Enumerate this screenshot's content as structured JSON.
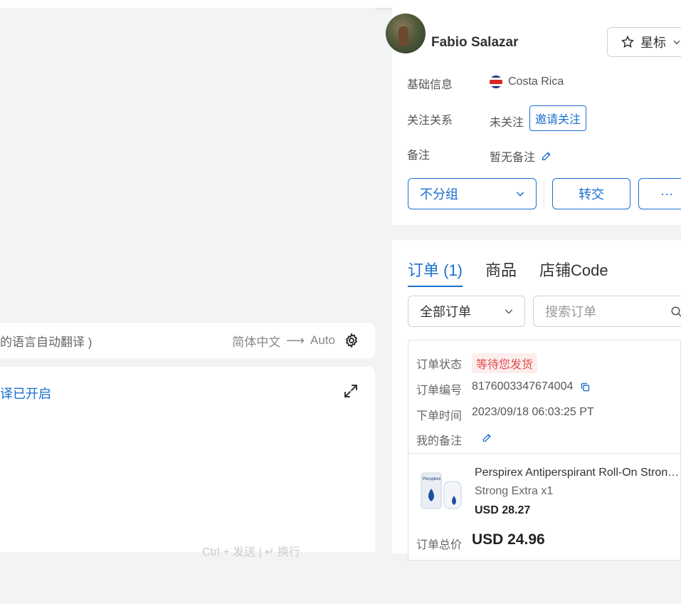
{
  "chat": {
    "translate_hint": "的语言自动翻译 )",
    "source_lang": "简体中文",
    "arrow": "⟶",
    "target_lang": "Auto",
    "editor_status": "译已开启",
    "send_hint": "Ctrl + 发送 | ↵ 换行"
  },
  "profile": {
    "name": "Fabio Salazar",
    "star_label": "星标",
    "basic_label": "基础信息",
    "country": "Costa Rica",
    "follow_label": "关注关系",
    "follow_value": "未关注",
    "invite_label": "邀请关注",
    "note_label": "备注",
    "note_value": "暂无备注",
    "group_value": "不分组",
    "transfer_label": "转交",
    "more_label": "···"
  },
  "orders": {
    "tabs": [
      {
        "label": "订单 (1)",
        "active": true
      },
      {
        "label": "商品",
        "active": false
      },
      {
        "label": "店铺Code",
        "active": false
      }
    ],
    "filter_value": "全部订单",
    "search_placeholder": "搜索订单",
    "order": {
      "status_label": "订单状态",
      "status_value": "等待您发货",
      "id_label": "订单编号",
      "id_value": "8176003347674004",
      "time_label": "下单时间",
      "time_value": "2023/09/18 06:03:25 PT",
      "remark_label": "我的备注",
      "product_title": "Perspirex Antiperspirant Roll-On Strong Extra",
      "product_variant": "Strong Extra x1",
      "product_price": "USD 28.27",
      "product_brand": "Perspirex",
      "total_label": "订单总价",
      "total_value": "USD 24.96"
    }
  },
  "colors": {
    "accent": "#1a6fd0",
    "status_red": "#e24d4d"
  }
}
